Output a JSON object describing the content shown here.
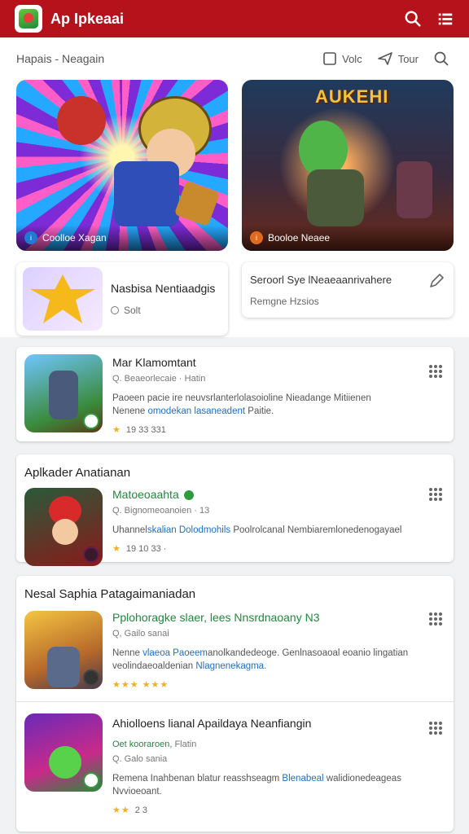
{
  "header": {
    "title": "Ap Ipkeaai",
    "brand_color": "#b5121b"
  },
  "subbar": {
    "title": "Hapais - Neagain",
    "action_vote": "Volc",
    "action_tour": "Tour"
  },
  "featured": [
    {
      "caption": "Coolloe Xagan",
      "caption_color": "#1f7ad1",
      "info_title": "Nasbisa Nentiaadgis",
      "info_sub": "Solt"
    },
    {
      "art_title": "AUKEHI",
      "caption": "Booloe Neaee",
      "caption_color": "#e06b1f",
      "info_title": "Seroorl Sye lNeaeaanrivahere",
      "info_sub": "Remgne Hzsios"
    }
  ],
  "list1": {
    "title": "Mar Klamomtant",
    "sub": "Q. Beaeorlecaie · Hatin",
    "desc_a": "Paoeen pacie ire neuvsrlanterlolasoioline Nieadange Mitiienen",
    "desc_b": "Nenene",
    "desc_link": "omodekan lasaneadent",
    "desc_c": "Paitie.",
    "rating": "19 33 331"
  },
  "list2": {
    "section": "Aplkader Anatianan",
    "title": "Matoeoaahta",
    "sub": "Q. Bignomeoanoien · 13",
    "desc_a": "Uhanne",
    "desc_link": "lskalian Dolodmohils",
    "desc_c": "Poolrolcanal Nembiaremlonedenogayael",
    "rating": "19 10 33 ·"
  },
  "list3": {
    "section": "Nesal Saphia Patagaimaniadan",
    "items": [
      {
        "title": "Pplohoragke slaer, lees Nnsrdnaoany N3",
        "sub": "Q, Gailo sanai",
        "desc_a": "Nenne",
        "desc_link_a": "vlaeoa Paoeem",
        "desc_b": "anolkandedeoge. Genlnasoaoal eoanio lingatian",
        "desc_c": "veolindaeoaldenian",
        "desc_link_b": "Nlagnenekagma."
      },
      {
        "title": "Ahiolloens lianal Apaildaya Neanfiangin",
        "sub_highlight": "Oet kooraroen,",
        "sub_tail": "Flatin",
        "sub2": "Q. Galo sania",
        "desc_a": "Remena Inahbenan blatur reasshseagm",
        "desc_link": "Blenabeal",
        "desc_b": "walidionedeageas",
        "desc_c": "Nvvioeoant.",
        "rating": "2 3"
      }
    ]
  }
}
